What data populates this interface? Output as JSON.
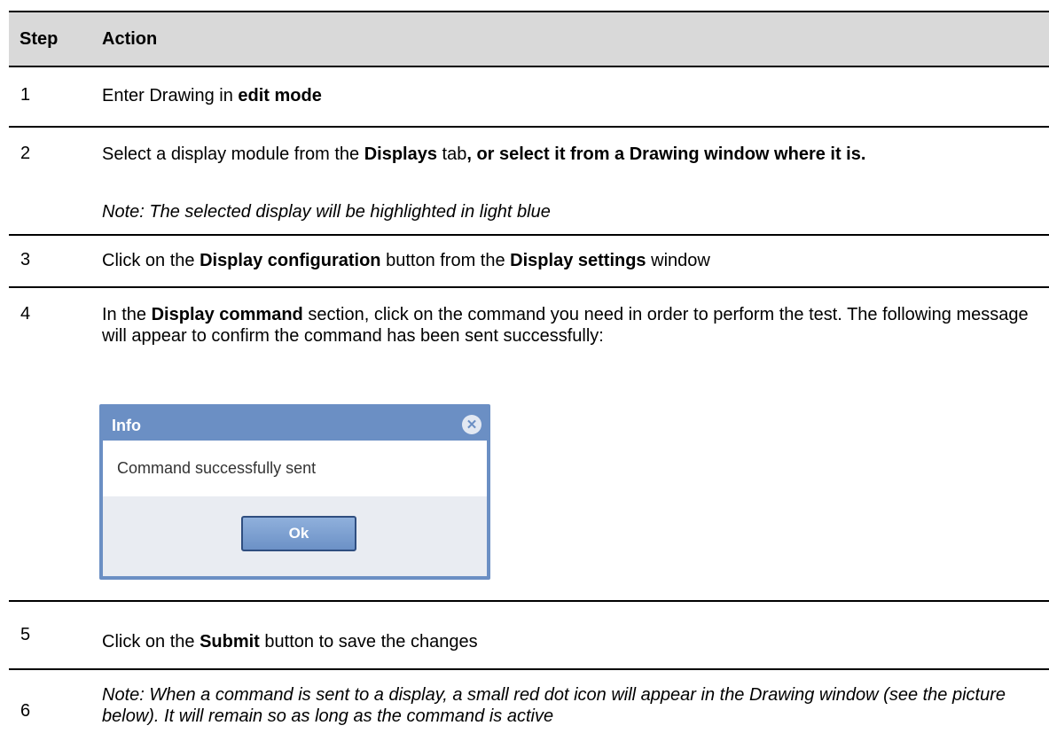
{
  "table": {
    "header": {
      "step": "Step",
      "action": "Action"
    },
    "rows": [
      {
        "num": "1",
        "parts": [
          "Enter Drawing in ",
          "edit mode"
        ]
      },
      {
        "num": "2",
        "parts": [
          "Select a display module from the ",
          "Displays",
          " tab",
          ", or select it from a Drawing window where it is."
        ],
        "note": "Note: The selected display will be highlighted in light blue"
      },
      {
        "num": "3",
        "parts": [
          "Click on the ",
          "Display configuration",
          " button from the ",
          "Display settings",
          " window"
        ]
      },
      {
        "num": "4",
        "parts": [
          "In the ",
          "Display command",
          " section, click on the command you need in order to perform the test. The following message will appear to confirm the command has been sent successfully:"
        ]
      },
      {
        "num": "5",
        "parts": [
          "Click on the ",
          "Submit",
          " button to save the changes"
        ]
      },
      {
        "num": "6",
        "note": "Note: When a command is sent to a display, a small red dot icon will appear in the Drawing window (see the picture below). It will remain so as long as the command is active"
      }
    ]
  },
  "dialog": {
    "title": "Info",
    "message": "Command successfully sent",
    "ok_label": "Ok",
    "close_icon": "close-circle-icon",
    "colors": {
      "frame": "#6b8fc4",
      "footer": "#e9ecf2",
      "button_border": "#2f4e80"
    }
  }
}
